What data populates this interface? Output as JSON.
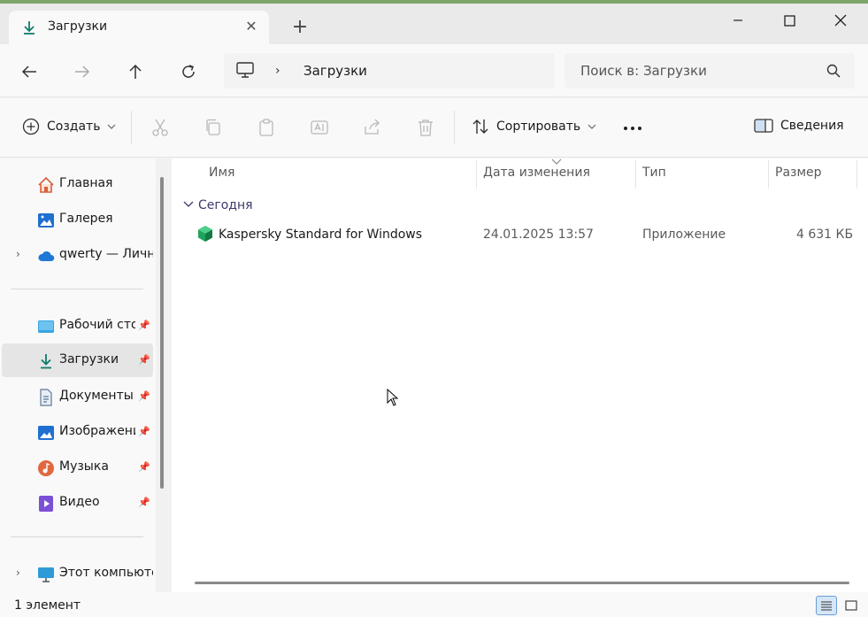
{
  "tab": {
    "title": "Загрузки"
  },
  "address": {
    "folder": "Загрузки"
  },
  "search": {
    "placeholder": "Поиск в: Загрузки"
  },
  "toolbar": {
    "create_label": "Создать",
    "sort_label": "Сортировать",
    "details_label": "Сведения"
  },
  "sidebar": {
    "items": [
      {
        "label": "Главная",
        "icon": "home-icon"
      },
      {
        "label": "Галерея",
        "icon": "gallery-icon"
      },
      {
        "label": "qwerty — Личный",
        "icon": "onedrive-cloud-icon"
      },
      {
        "label": "Рабочий стол",
        "icon": "desktop-icon"
      },
      {
        "label": "Загрузки",
        "icon": "download-icon"
      },
      {
        "label": "Документы",
        "icon": "documents-icon"
      },
      {
        "label": "Изображения",
        "icon": "pictures-icon"
      },
      {
        "label": "Музыка",
        "icon": "music-icon"
      },
      {
        "label": "Видео",
        "icon": "video-icon"
      },
      {
        "label": "Этот компьютер",
        "icon": "this-pc-icon"
      }
    ]
  },
  "columns": {
    "name": "Имя",
    "date": "Дата изменения",
    "type": "Тип",
    "size": "Размер"
  },
  "group": {
    "label": "Сегодня"
  },
  "files": [
    {
      "name": "Kaspersky Standard for Windows",
      "date": "24.01.2025 13:57",
      "type": "Приложение",
      "size": "4 631 КБ"
    }
  ],
  "status": {
    "count": "1 элемент"
  },
  "colors": {
    "accent": "#0f7b6c",
    "selected_bg": "#e5e5e5",
    "kaspersky_green": "#1fa35c"
  }
}
